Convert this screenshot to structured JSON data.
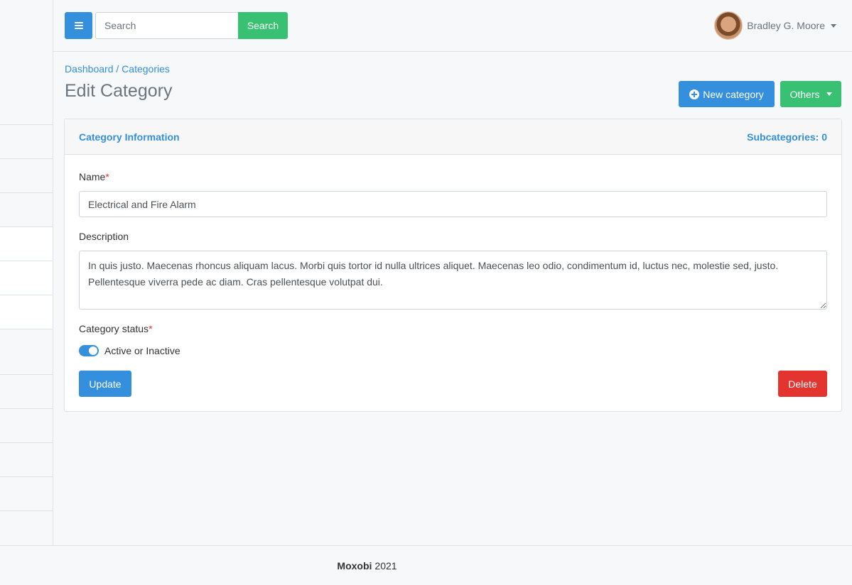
{
  "topbar": {
    "search_placeholder": "Search",
    "search_button": "Search",
    "user_name": "Bradley G. Moore"
  },
  "breadcrumb": {
    "dashboard": "Dashboard",
    "separator": "/",
    "categories": "Categories"
  },
  "page": {
    "title": "Edit Category",
    "new_button": "New category",
    "others_button": "Others"
  },
  "card": {
    "header_title": "Category Information",
    "subcategories": "Subcategories: 0",
    "name_label": "Name",
    "required_mark": "*",
    "name_value": "Electrical and Fire Alarm",
    "description_label": "Description",
    "description_value": "In quis justo. Maecenas rhoncus aliquam lacus. Morbi quis tortor id nulla ultrices aliquet. Maecenas leo odio, condimentum id, luctus nec, molestie sed, justo. Pellentesque viverra pede ac diam. Cras pellentesque volutpat dui.",
    "status_label": "Category status",
    "toggle_label": "Active or Inactive",
    "status_active": true,
    "update_button": "Update",
    "delete_button": "Delete"
  },
  "footer": {
    "brand": "Moxobi",
    "year": "2021"
  },
  "colors": {
    "primary": "#3490dc",
    "success": "#38c172",
    "danger": "#e3342f"
  },
  "icons": [
    "hamburger-icon",
    "plus-circle-icon",
    "caret-down-icon"
  ]
}
